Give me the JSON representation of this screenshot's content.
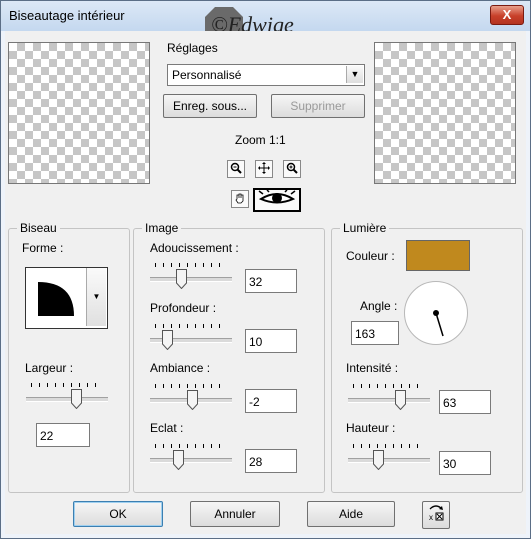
{
  "window": {
    "title": "Biseautage intérieur",
    "close_label": "X"
  },
  "watermark": {
    "text": "©Edwige"
  },
  "presets": {
    "label": "Réglages",
    "selected": "Personnalisé",
    "save_label": "Enreg. sous...",
    "delete_label": "Supprimer"
  },
  "preview": {
    "zoom_label": "Zoom 1:1"
  },
  "biseau": {
    "legend": "Biseau",
    "forme_label": "Forme :",
    "largeur_label": "Largeur :",
    "largeur_value": "22",
    "largeur_level": 0.6
  },
  "image": {
    "legend": "Image",
    "adoucissement_label": "Adoucissement :",
    "adoucissement_value": "32",
    "adoucissement_level": 0.32,
    "profondeur_label": "Profondeur :",
    "profondeur_value": "10",
    "profondeur_level": 0.1,
    "ambiance_label": "Ambiance :",
    "ambiance_value": "-2",
    "ambiance_level": 0.49,
    "eclat_label": "Eclat :",
    "eclat_value": "28",
    "eclat_level": 0.28
  },
  "lumiere": {
    "legend": "Lumière",
    "couleur_label": "Couleur :",
    "couleur_value": "#c0891e",
    "angle_label": "Angle :",
    "angle_value": "163",
    "intensite_label": "Intensité :",
    "intensite_value": "63",
    "intensite_level": 0.63,
    "hauteur_label": "Hauteur :",
    "hauteur_value": "30",
    "hauteur_level": 0.3
  },
  "buttons": {
    "ok": "OK",
    "annuler": "Annuler",
    "aide": "Aide"
  },
  "icons": {
    "zoom_out": "zoom-out-icon",
    "pan": "pan-icon",
    "zoom_in": "zoom-in-icon",
    "hand": "hand-icon",
    "eye": "eye-icon",
    "forme_dropdown": "chevron-down-icon",
    "reset": "reset-icon"
  }
}
